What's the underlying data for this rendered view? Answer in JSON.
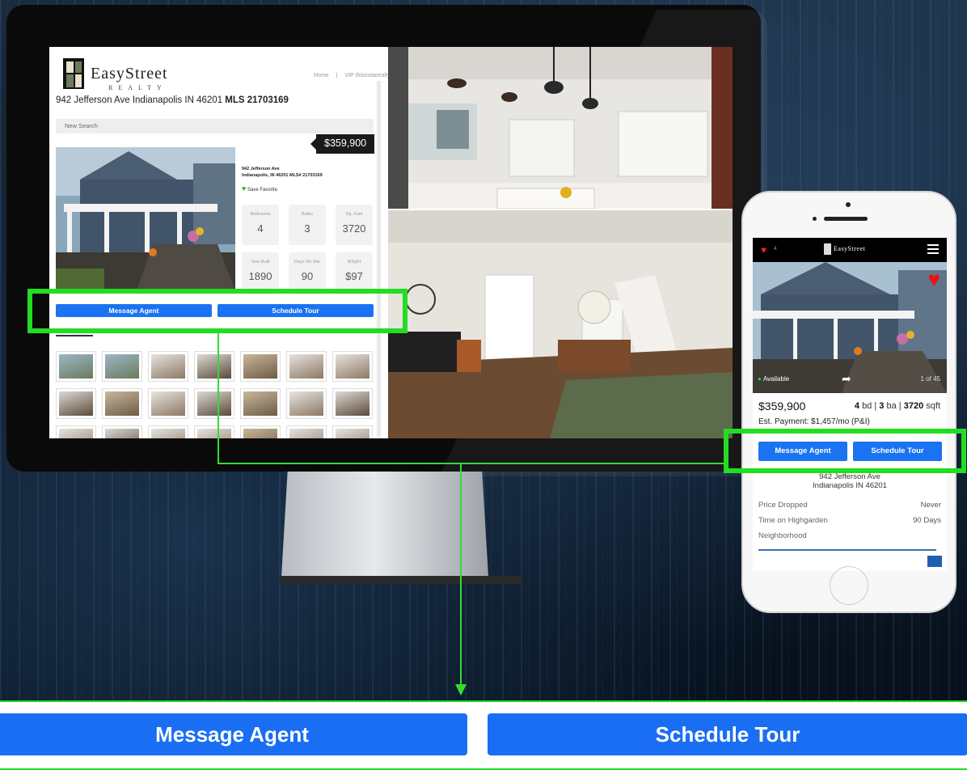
{
  "desktop": {
    "logo": {
      "name": "EasyStreet",
      "sub": "REALTY"
    },
    "nav": [
      "Home",
      "|",
      "VIP thisinstarealty"
    ],
    "title_address": "942 Jefferson Ave Indianapolis IN 46201",
    "title_mls": "MLS 21703169",
    "new_search": "New Search",
    "price": "$359,900",
    "address_line1": "942 Jefferson Ave",
    "address_line2": "Indianapolis, IN 46201 MLS# 21703169",
    "save_favorite": "Save Favorite",
    "stats": [
      {
        "label": "Bedrooms",
        "value": "4"
      },
      {
        "label": "Baths",
        "value": "3"
      },
      {
        "label": "Sq. Feet",
        "value": "3720"
      },
      {
        "label": "Year Built",
        "value": "1890"
      },
      {
        "label": "Days On Site",
        "value": "90"
      },
      {
        "label": "$/SqFt",
        "value": "$97"
      }
    ],
    "message_agent": "Message Agent",
    "schedule_tour": "Schedule Tour",
    "photos_count": "44 Photos"
  },
  "mobile": {
    "favorites_count": "4",
    "brand": "EasyStreet",
    "photo_available": "Available",
    "photo_counter": "1 of 45",
    "price": "$359,900",
    "beds": "4",
    "beds_label": "bd",
    "baths": "3",
    "baths_label": "ba",
    "sqft": "3720",
    "sqft_label": "sqft",
    "est_payment": "Est. Payment: $1,457/mo (P&I)",
    "message_agent": "Message Agent",
    "schedule_tour": "Schedule Tour",
    "address_line1": "942 Jefferson Ave",
    "address_line2": "Indianapolis IN 46201",
    "rows": [
      {
        "label": "Price Dropped",
        "value": "Never"
      },
      {
        "label": "Time on Highgarden",
        "value": "90 Days"
      },
      {
        "label": "Neighborhood",
        "value": ""
      }
    ]
  },
  "zoom": {
    "message_agent": "Message Agent",
    "schedule_tour": "Schedule Tour"
  },
  "colors": {
    "button_blue": "#1a73f0",
    "highlight_green": "#22dd22",
    "favorite_red": "#ee1111"
  }
}
